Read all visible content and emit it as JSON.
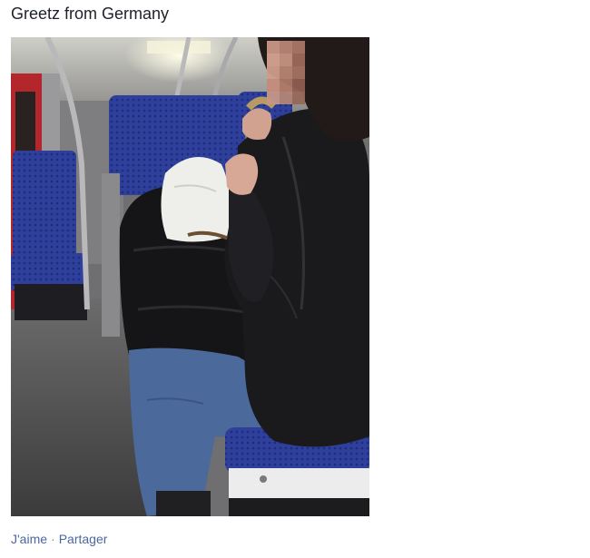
{
  "post": {
    "title": "Greetz from Germany",
    "photo": {
      "subject": "photo of a passenger eating on a train with blue seats",
      "colors": {
        "seat_blue": "#2e3f9c",
        "jacket_black": "#1a1a1c",
        "jeans_blue": "#4b6a9b",
        "floor_grey": "#555455",
        "wall_grey": "#8c8c90",
        "door_red": "#b3262b"
      }
    },
    "actions": {
      "like_label": "J'aime",
      "separator": "·",
      "share_label": "Partager"
    }
  }
}
